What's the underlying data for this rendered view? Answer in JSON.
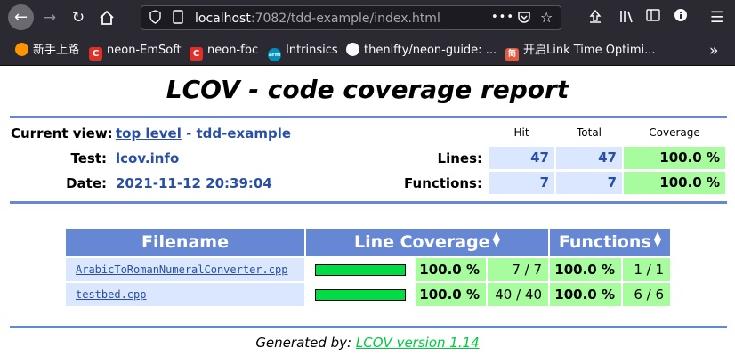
{
  "browser": {
    "url_host": "localhost",
    "url_path": ":7082/tdd-example/index.html",
    "bookmarks": [
      {
        "label": "新手上路"
      },
      {
        "label": "neon-EmSoft"
      },
      {
        "label": "neon-fbc"
      },
      {
        "label": "Intrinsics"
      },
      {
        "label": "thenifty/neon-guide: ..."
      },
      {
        "label": "开启Link Time Optimi..."
      }
    ]
  },
  "report": {
    "title": "LCOV - code coverage report",
    "current_view_label": "Current view:",
    "current_view_link": "top level",
    "current_view_sep": " - ",
    "current_view_name": "tdd-example",
    "test_label": "Test:",
    "test_value": "lcov.info",
    "date_label": "Date:",
    "date_value": "2021-11-12 20:39:04",
    "hit_header": "Hit",
    "total_header": "Total",
    "coverage_header": "Coverage",
    "lines_label": "Lines:",
    "lines_hit": "47",
    "lines_total": "47",
    "lines_coverage": "100.0 %",
    "functions_label": "Functions:",
    "functions_hit": "7",
    "functions_total": "7",
    "functions_coverage": "100.0 %"
  },
  "file_table": {
    "headers": {
      "filename": "Filename",
      "line_coverage": "Line Coverage",
      "functions": "Functions"
    },
    "rows": [
      {
        "file": "ArabicToRomanNumeralConverter.cpp",
        "bar_fraction": 1.0,
        "line_pct": "100.0 %",
        "line_count": "7 / 7",
        "func_pct": "100.0 %",
        "func_count": "1 / 1"
      },
      {
        "file": "testbed.cpp",
        "bar_fraction": 1.0,
        "line_pct": "100.0 %",
        "line_count": "40 / 40",
        "func_pct": "100.0 %",
        "func_count": "6 / 6"
      }
    ]
  },
  "footer": {
    "generated_by": "Generated by:",
    "tool_link": "LCOV version 1.14"
  }
}
